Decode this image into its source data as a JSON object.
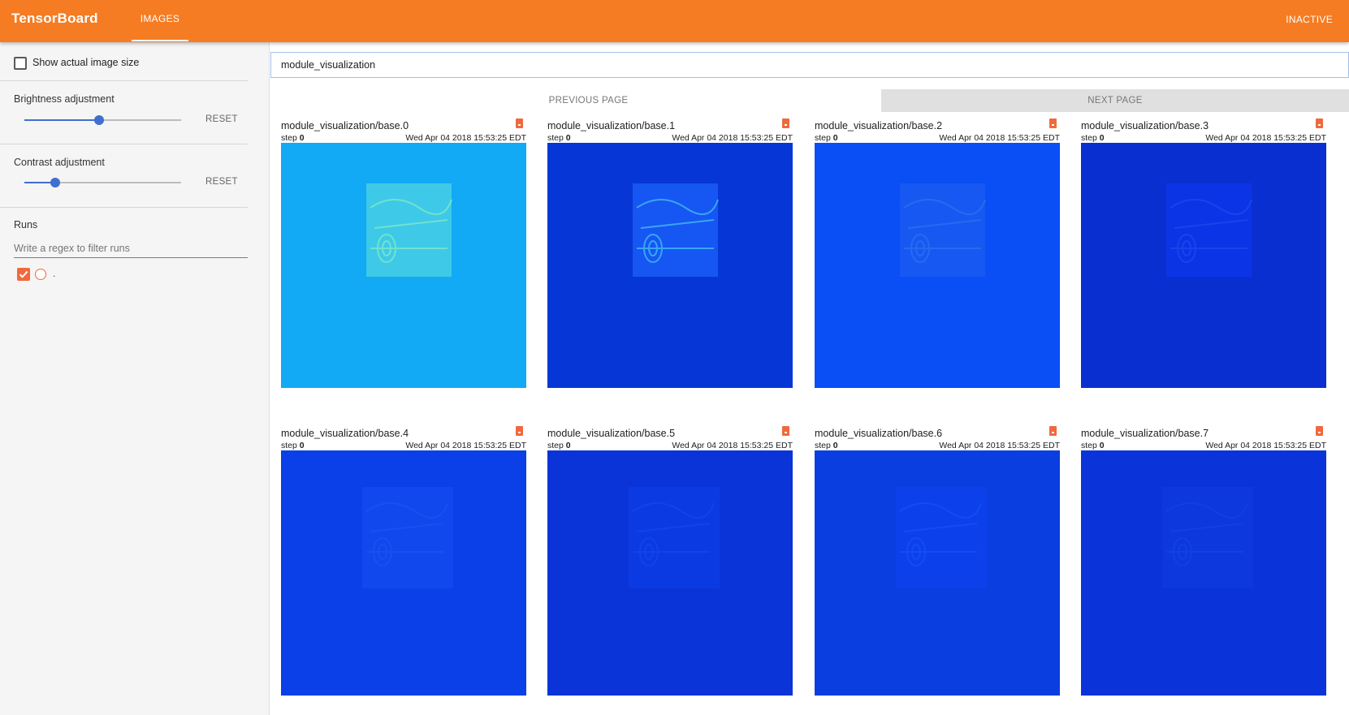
{
  "header": {
    "brand": "TensorBoard",
    "tab": "IMAGES",
    "status": "INACTIVE"
  },
  "sidebar": {
    "show_actual_size": "Show actual image size",
    "brightness": {
      "label": "Brightness adjustment",
      "reset": "RESET",
      "value": 0.5
    },
    "contrast": {
      "label": "Contrast adjustment",
      "reset": "RESET",
      "value": 0.2
    },
    "runs": {
      "title": "Runs",
      "filter_placeholder": "Write a regex to filter runs",
      "items": [
        {
          "name": ".",
          "checked": true
        }
      ]
    }
  },
  "main": {
    "tag_filter": "module_visualization",
    "prev_page": "PREVIOUS PAGE",
    "next_page": "NEXT PAGE",
    "cards": [
      {
        "name": "module_visualization/base.0",
        "step_label": "step",
        "step": "0",
        "time": "Wed Apr 04 2018 15:53:25 EDT",
        "bg": "#12a9f5",
        "inner": "#3fc9e8",
        "edge": "#78e8c8"
      },
      {
        "name": "module_visualization/base.1",
        "step_label": "step",
        "step": "0",
        "time": "Wed Apr 04 2018 15:53:25 EDT",
        "bg": "#0636d6",
        "inner": "#1656f2",
        "edge": "#3fb4f5"
      },
      {
        "name": "module_visualization/base.2",
        "step_label": "step",
        "step": "0",
        "time": "Wed Apr 04 2018 15:53:25 EDT",
        "bg": "#0a4ef5",
        "inner": "#1758f2",
        "edge": "#2a6ef0"
      },
      {
        "name": "module_visualization/base.3",
        "step_label": "step",
        "step": "0",
        "time": "Wed Apr 04 2018 15:53:25 EDT",
        "bg": "#0a2fd0",
        "inner": "#0b34e6",
        "edge": "#1a48ec"
      },
      {
        "name": "module_visualization/base.4",
        "step_label": "step",
        "step": "0",
        "time": "Wed Apr 04 2018 15:53:25 EDT",
        "bg": "#0b3fe8",
        "inner": "#1148ee",
        "edge": "#1a52f0"
      },
      {
        "name": "module_visualization/base.5",
        "step_label": "step",
        "step": "0",
        "time": "Wed Apr 04 2018 15:53:25 EDT",
        "bg": "#0a33d8",
        "inner": "#0c3ae2",
        "edge": "#1444ec"
      },
      {
        "name": "module_visualization/base.6",
        "step_label": "step",
        "step": "0",
        "time": "Wed Apr 04 2018 15:53:25 EDT",
        "bg": "#0a3ee0",
        "inner": "#0c40ea",
        "edge": "#1250f4"
      },
      {
        "name": "module_visualization/base.7",
        "step_label": "step",
        "step": "0",
        "time": "Wed Apr 04 2018 15:53:25 EDT",
        "bg": "#0a33da",
        "inner": "#0c38de",
        "edge": "#1242e6"
      }
    ]
  }
}
